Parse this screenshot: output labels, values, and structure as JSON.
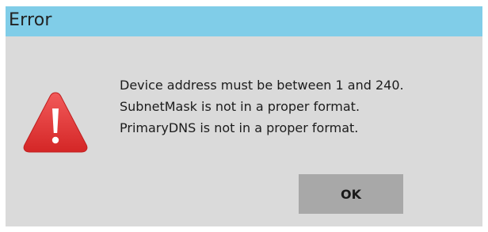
{
  "window": {
    "title": "Error"
  },
  "dialog": {
    "icon": "warning-triangle-icon",
    "messages": [
      "Device address must be between 1 and 240.",
      "SubnetMask is not in a proper format.",
      "PrimaryDNS is not in a proper format."
    ],
    "ok_label": "OK"
  },
  "colors": {
    "titlebar": "#80cde8",
    "dialog_bg": "#dadada",
    "button_bg": "#a8a8a8",
    "icon_red": "#e23a3a"
  }
}
